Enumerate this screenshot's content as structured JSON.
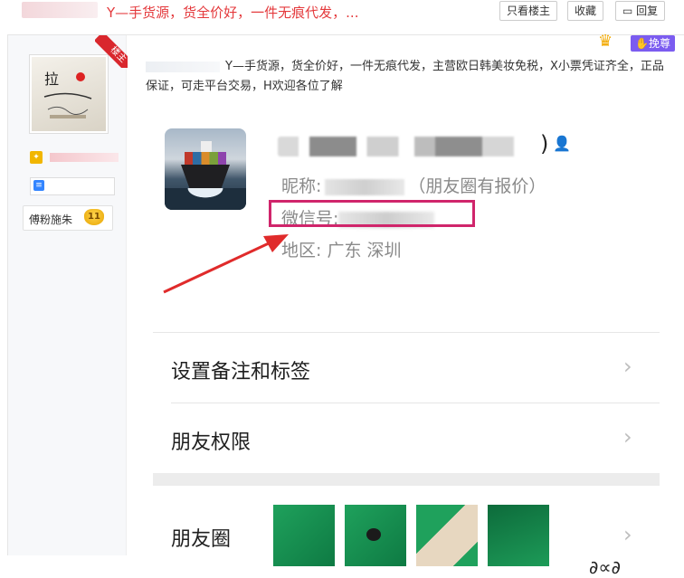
{
  "header": {
    "thread_title": "Y—手货源，货全价好，一件无痕代发，...",
    "buttons": {
      "only_op": "只看楼主",
      "favorite": "收藏",
      "reply": "回复"
    }
  },
  "post": {
    "op_badge": "楼主",
    "zun_label": "挽尊",
    "body_text": "Y—手货源，货全价好，一件无痕代发，主营欧日韩美妆免税，X小票凭证齐全，正品保证，可走平台交易，H欢迎各位了解",
    "author": {
      "fan_title": "傅粉施朱",
      "fan_level": "11"
    }
  },
  "screenshot": {
    "name_paren_close": ")",
    "nickname_label": "昵称:",
    "nickname_suffix": "（朋友圈有报价）",
    "wechat_id_label": "微信号:",
    "region_label": "地区:",
    "region_value": "广东  深圳",
    "menu": {
      "remark_tags": "设置备注和标签",
      "friend_permission": "朋友权限",
      "moments": "朋友圈"
    },
    "chevron": "›"
  },
  "colors": {
    "title_red": "#e4393c",
    "highlight_box": "#d0256b",
    "arrow": "#e02b2b",
    "zun_purple": "#7b5cf0"
  }
}
